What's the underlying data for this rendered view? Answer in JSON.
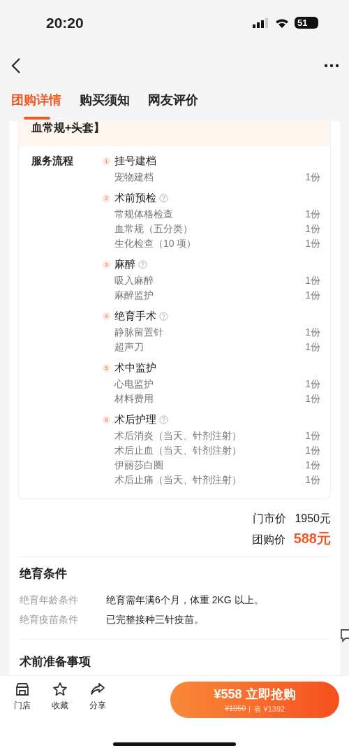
{
  "status_bar": {
    "time": "20:20",
    "battery": "51"
  },
  "tabs": [
    {
      "label": "团购详情",
      "selected": true
    },
    {
      "label": "购买须知",
      "selected": false
    },
    {
      "label": "网友评价",
      "selected": false
    }
  ],
  "package_header": {
    "title": "血常规+头套】"
  },
  "service_flow": {
    "label": "服务流程",
    "steps": [
      {
        "number": "1",
        "title": "挂号建档",
        "info": false,
        "items": [
          {
            "name": "宠物建档",
            "qty": "1份"
          }
        ]
      },
      {
        "number": "2",
        "title": "术前预检",
        "info": true,
        "items": [
          {
            "name": "常规体格检查",
            "qty": "1份"
          },
          {
            "name": "血常规（五分类）",
            "qty": "1份"
          },
          {
            "name": "生化检查（10 项）",
            "qty": "1份"
          }
        ]
      },
      {
        "number": "3",
        "title": "麻醉",
        "info": true,
        "items": [
          {
            "name": "吸入麻醉",
            "qty": "1份"
          },
          {
            "name": "麻醉监护",
            "qty": "1份"
          }
        ]
      },
      {
        "number": "4",
        "title": "绝育手术",
        "info": true,
        "items": [
          {
            "name": "静脉留置针",
            "qty": "1份"
          },
          {
            "name": "超声刀",
            "qty": "1份"
          }
        ]
      },
      {
        "number": "5",
        "title": "术中监护",
        "info": false,
        "items": [
          {
            "name": "心电监护",
            "qty": "1份"
          },
          {
            "name": "材料费用",
            "qty": "1份"
          }
        ]
      },
      {
        "number": "6",
        "title": "术后护理",
        "info": true,
        "items": [
          {
            "name": "术后消炎（当天、针剂注射）",
            "qty": "1份"
          },
          {
            "name": "术后止血（当天、针剂注射）",
            "qty": "1份"
          },
          {
            "name": "伊丽莎白圈",
            "qty": "1份"
          },
          {
            "name": "术后止痛（当天、针剂注射）",
            "qty": "1份"
          }
        ]
      }
    ]
  },
  "prices": [
    {
      "kind": "regular",
      "label": "门市价",
      "value": "1950元"
    },
    {
      "kind": "deal",
      "label": "团购价",
      "value": "588元"
    }
  ],
  "conditions": {
    "title": "绝育条件",
    "rows": [
      {
        "label": "绝育年龄条件",
        "value": "绝育需年满6个月，体重 2KG 以上。"
      },
      {
        "label": "绝育疫苗条件",
        "value": "已完整接种三针疫苗。"
      }
    ]
  },
  "next_section": {
    "title": "术前准备事项"
  },
  "bottom_bar": {
    "actions": [
      {
        "kind": "store",
        "label": "门店"
      },
      {
        "kind": "star",
        "label": "收藏"
      },
      {
        "kind": "share",
        "label": "分享"
      }
    ],
    "buy_button": {
      "price": "¥558",
      "label": "立即抢购",
      "original": "¥1950",
      "saving": "省 ¥1392"
    }
  }
}
